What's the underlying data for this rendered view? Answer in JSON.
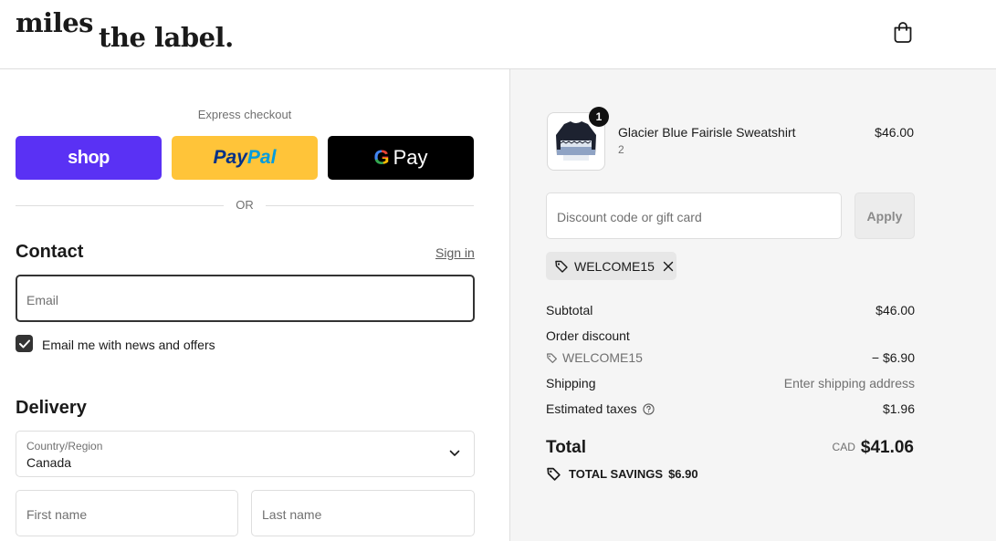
{
  "header": {
    "logo_line1": "miles",
    "logo_line2": "the label."
  },
  "express": {
    "label": "Express checkout",
    "shop_label": "shop",
    "paypal_part1": "Pay",
    "paypal_part2": "Pal",
    "gpay_g": "G",
    "gpay_label": "Pay",
    "or_label": "OR"
  },
  "contact": {
    "heading": "Contact",
    "sign_in": "Sign in",
    "email_placeholder": "Email",
    "newsletter_label": "Email me with news and offers",
    "newsletter_checked": true
  },
  "delivery": {
    "heading": "Delivery",
    "country_label": "Country/Region",
    "country_value": "Canada",
    "first_name_placeholder": "First name",
    "last_name_placeholder": "Last name"
  },
  "order": {
    "item": {
      "name": "Glacier Blue Fairisle Sweatshirt",
      "variant": "2",
      "price": "$46.00",
      "quantity": "1"
    },
    "discount_placeholder": "Discount code or gift card",
    "apply_label": "Apply",
    "applied_code": "WELCOME15",
    "subtotal_label": "Subtotal",
    "subtotal_value": "$46.00",
    "order_discount_label": "Order discount",
    "discount_code": "WELCOME15",
    "discount_value": "− $6.90",
    "shipping_label": "Shipping",
    "shipping_value": "Enter shipping address",
    "taxes_label": "Estimated taxes",
    "taxes_value": "$1.96",
    "total_label": "Total",
    "total_currency": "CAD",
    "total_value": "$41.06",
    "savings_label": "TOTAL SAVINGS",
    "savings_value": "$6.90"
  },
  "colors": {
    "shop_brand": "#5a31f4",
    "paypal_yellow": "#ffc439",
    "gpay_black": "#000000",
    "summary_bg": "#f5f5f5"
  }
}
